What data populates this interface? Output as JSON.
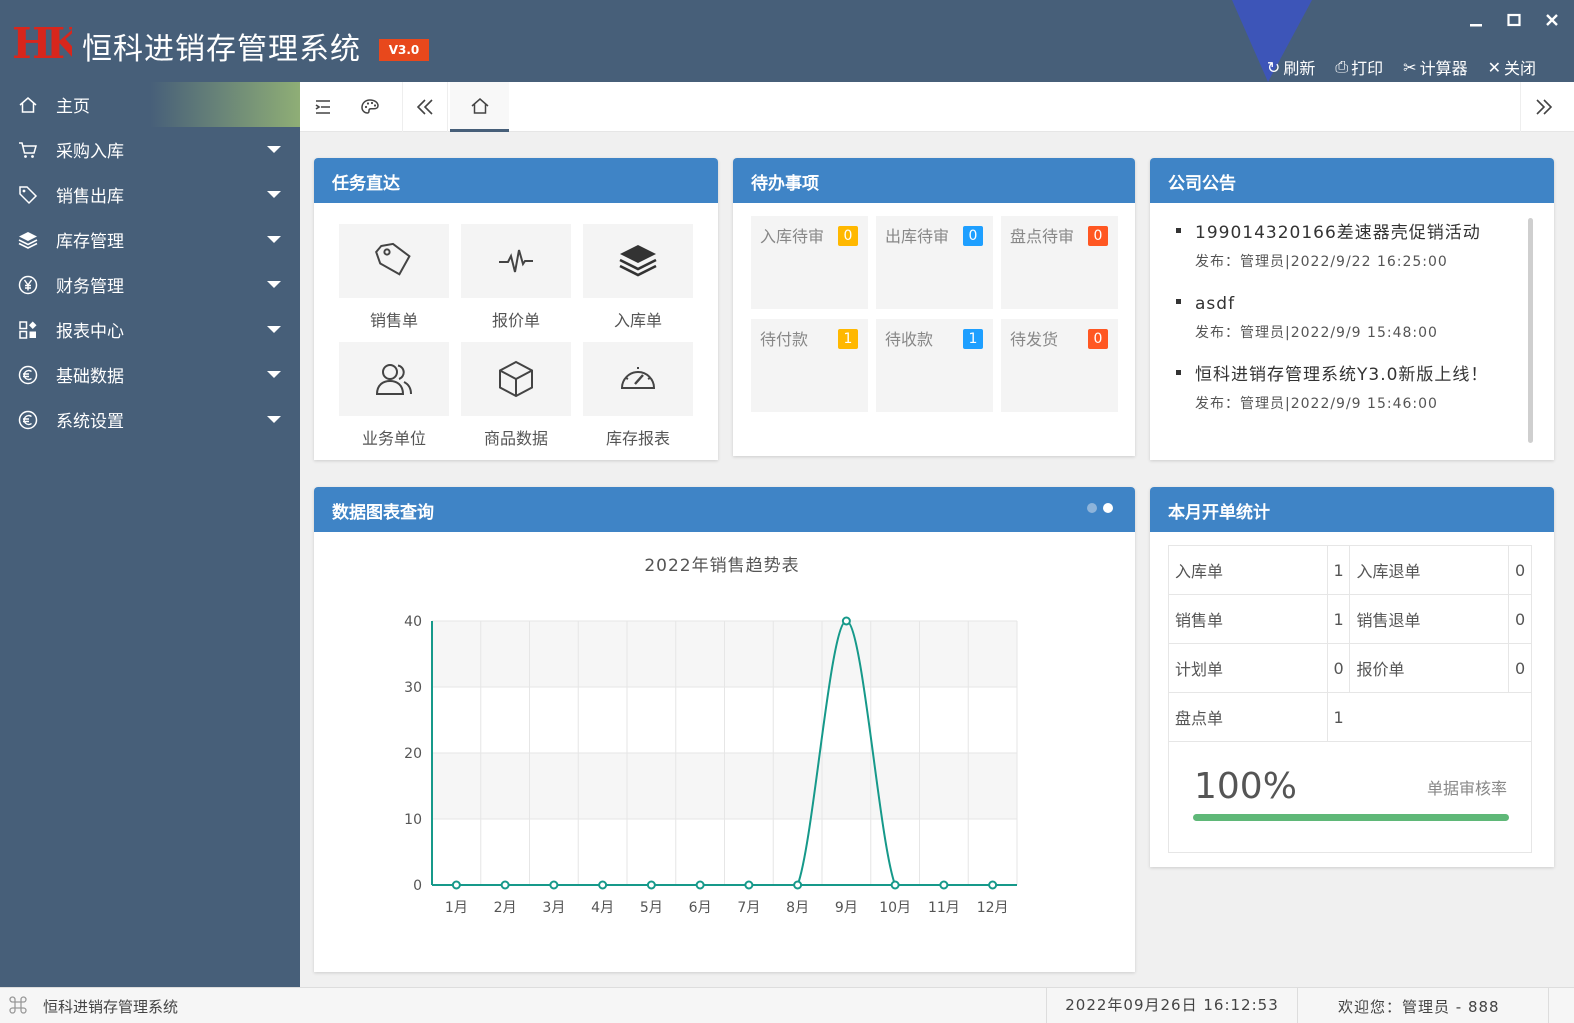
{
  "app": {
    "title": "恒科进销存管理系统",
    "version": "V3.0",
    "logo_text": "HK"
  },
  "toolbar": {
    "refresh": "刷新",
    "print": "打印",
    "calculator": "计算器",
    "close": "关闭"
  },
  "sidebar": {
    "items": [
      {
        "label": "主页",
        "icon": "home-icon"
      },
      {
        "label": "采购入库",
        "icon": "cart-icon"
      },
      {
        "label": "销售出库",
        "icon": "tag-icon"
      },
      {
        "label": "库存管理",
        "icon": "layers-icon"
      },
      {
        "label": "财务管理",
        "icon": "yen-icon"
      },
      {
        "label": "报表中心",
        "icon": "grid-icon"
      },
      {
        "label": "基础数据",
        "icon": "euro-icon"
      },
      {
        "label": "系统设置",
        "icon": "euro-icon"
      }
    ]
  },
  "tasks": {
    "title": "任务直达",
    "items": [
      {
        "label": "销售单",
        "icon": "tag-icon"
      },
      {
        "label": "报价单",
        "icon": "pulse-icon"
      },
      {
        "label": "入库单",
        "icon": "layers-icon"
      },
      {
        "label": "业务单位",
        "icon": "users-icon"
      },
      {
        "label": "商品数据",
        "icon": "cube-icon"
      },
      {
        "label": "库存报表",
        "icon": "gauge-icon"
      }
    ]
  },
  "todo": {
    "title": "待办事项",
    "items": [
      {
        "label": "入库待审",
        "count": "0",
        "color": "#ffb800"
      },
      {
        "label": "出库待审",
        "count": "0",
        "color": "#1e9fff"
      },
      {
        "label": "盘点待审",
        "count": "0",
        "color": "#ff5722"
      },
      {
        "label": "待付款",
        "count": "1",
        "color": "#ffb800"
      },
      {
        "label": "待收款",
        "count": "1",
        "color": "#1e9fff"
      },
      {
        "label": "待发货",
        "count": "0",
        "color": "#ff5722"
      }
    ]
  },
  "notice": {
    "title": "公司公告",
    "items": [
      {
        "title": "199014320166差速器壳促销活动",
        "meta": "发布：管理员|2022/9/22 16:25:00"
      },
      {
        "title": "asdf",
        "meta": "发布：管理员|2022/9/9 15:48:00"
      },
      {
        "title": "恒科进销存管理系统Y3.0新版上线！",
        "meta": "发布：管理员|2022/9/9 15:46:00"
      }
    ]
  },
  "chart_panel": {
    "title": "数据图表查询"
  },
  "chart_data": {
    "type": "line",
    "title": "2022年销售趋势表",
    "categories": [
      "1月",
      "2月",
      "3月",
      "4月",
      "5月",
      "6月",
      "7月",
      "8月",
      "9月",
      "10月",
      "11月",
      "12月"
    ],
    "values": [
      0,
      0,
      0,
      0,
      0,
      0,
      0,
      0,
      40,
      0,
      0,
      0
    ],
    "ylim": [
      0,
      40
    ],
    "yticks": [
      "0",
      "10",
      "20",
      "30",
      "40"
    ],
    "color": "#16998a",
    "grid": true
  },
  "stats": {
    "title": "本月开单统计",
    "rows": [
      [
        {
          "label": "入库单",
          "value": "1"
        },
        {
          "label": "入库退单",
          "value": "0"
        }
      ],
      [
        {
          "label": "销售单",
          "value": "1"
        },
        {
          "label": "销售退单",
          "value": "0"
        }
      ],
      [
        {
          "label": "计划单",
          "value": "0"
        },
        {
          "label": "报价单",
          "value": "0"
        }
      ]
    ],
    "last": {
      "label": "盘点单",
      "value": "1"
    },
    "rate_value": "100%",
    "rate_label": "单据审核率",
    "rate_fraction": 1.0
  },
  "status": {
    "app_name": "恒科进销存管理系统",
    "datetime": "2022年09月26日 16:12:53",
    "user": "欢迎您：管理员 - 888"
  },
  "colors": {
    "sidebar": "#475f79",
    "panel_header": "#3f84c6",
    "accent_green": "#5fb878"
  }
}
